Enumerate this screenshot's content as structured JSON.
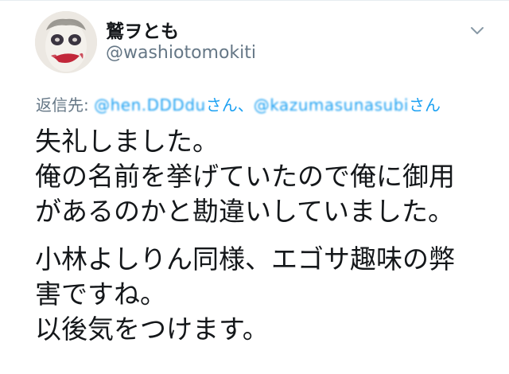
{
  "author": {
    "display_name": "鷲ヲとも",
    "handle": "@washiotomokiti"
  },
  "reply": {
    "prefix": "返信先: ",
    "mention1": "@hen.DDDdu",
    "suffix1": "さん、",
    "mention2": "@kazumasunasubi",
    "suffix2": "さん"
  },
  "tweet": {
    "paragraph1": [
      "失礼しました。",
      "俺の名前を挙げていたので俺に御用",
      "があるのかと勘違いしていました。"
    ],
    "paragraph2": [
      "小林よしりん同様、エゴサ趣味の弊",
      "害ですね。",
      "以後気をつけます。"
    ]
  },
  "icons": {
    "caret": "chevron-down-icon"
  },
  "colors": {
    "link": "#1da1f2",
    "muted": "#657786",
    "text": "#14171a"
  }
}
